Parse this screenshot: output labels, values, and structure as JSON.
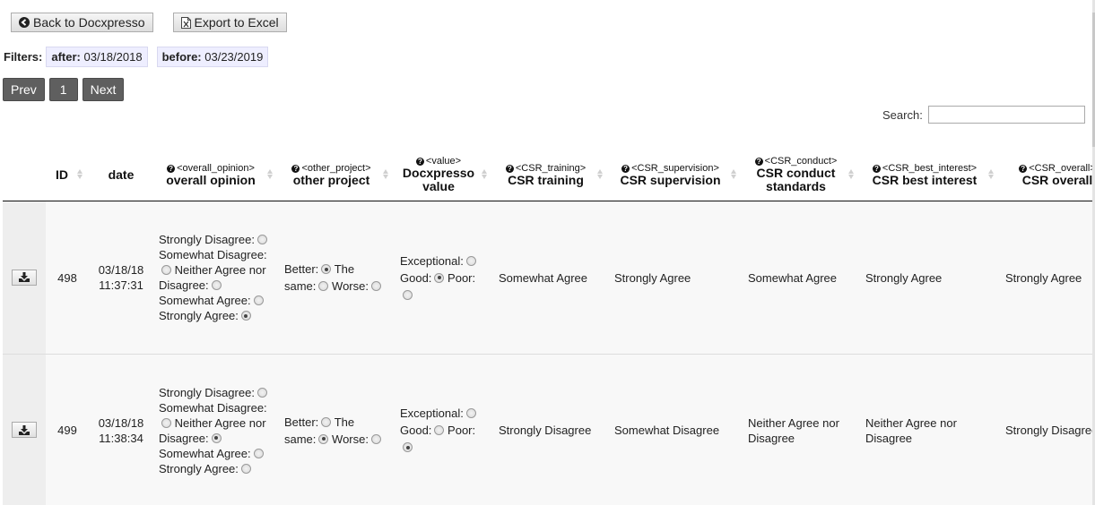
{
  "toolbar": {
    "back_label": "Back to Docxpresso",
    "export_label": "Export to Excel"
  },
  "filters": {
    "label": "Filters:",
    "after_key": "after:",
    "after_value": "03/18/2018",
    "before_key": "before:",
    "before_value": "03/23/2019"
  },
  "pager": {
    "prev": "Prev",
    "page": "1",
    "next": "Next"
  },
  "search": {
    "label": "Search:",
    "value": ""
  },
  "columns": [
    {
      "tag": "",
      "label": "ID"
    },
    {
      "tag": "",
      "label": "date"
    },
    {
      "tag": "<overall_opinion>",
      "label": "overall opinion"
    },
    {
      "tag": "<other_project>",
      "label": "other project"
    },
    {
      "tag": "<value>",
      "label": "Docxpresso value"
    },
    {
      "tag": "<CSR_training>",
      "label": "CSR training"
    },
    {
      "tag": "<CSR_supervision>",
      "label": "CSR supervision"
    },
    {
      "tag": "<CSR_conduct>",
      "label": "CSR conduct standards"
    },
    {
      "tag": "<CSR_best_interest>",
      "label": "CSR best interest"
    },
    {
      "tag": "<CSR_overall>",
      "label": "CSR overall"
    }
  ],
  "rows": [
    {
      "id": "498",
      "date_line1": "03/18/18",
      "date_line2": "11:37:31",
      "overall_opinion": [
        {
          "label": "Strongly Disagree:",
          "checked": false
        },
        {
          "label": "Somewhat Disagree:",
          "checked": false
        },
        {
          "label": "Neither Agree nor Disagree:",
          "checked": false
        },
        {
          "label": "Somewhat Agree:",
          "checked": false
        },
        {
          "label": "Strongly Agree:",
          "checked": true
        }
      ],
      "other_project": [
        {
          "label": "Better:",
          "checked": true
        },
        {
          "label": "The same:",
          "checked": false
        },
        {
          "label": "Worse:",
          "checked": false
        }
      ],
      "value": [
        {
          "label": "Exceptional:",
          "checked": false
        },
        {
          "label": "Good:",
          "checked": true
        },
        {
          "label": "Poor:",
          "checked": false
        }
      ],
      "csr_training": "Somewhat Agree",
      "csr_supervision": "Strongly Agree",
      "csr_conduct": "Somewhat Agree",
      "csr_best_interest": "Strongly Agree",
      "csr_overall": "Strongly Agree"
    },
    {
      "id": "499",
      "date_line1": "03/18/18",
      "date_line2": "11:38:34",
      "overall_opinion": [
        {
          "label": "Strongly Disagree:",
          "checked": false
        },
        {
          "label": "Somewhat Disagree:",
          "checked": false
        },
        {
          "label": "Neither Agree nor Disagree:",
          "checked": true
        },
        {
          "label": "Somewhat Agree:",
          "checked": false
        },
        {
          "label": "Strongly Agree:",
          "checked": false
        }
      ],
      "other_project": [
        {
          "label": "Better:",
          "checked": false
        },
        {
          "label": "The same:",
          "checked": true
        },
        {
          "label": "Worse:",
          "checked": false
        }
      ],
      "value": [
        {
          "label": "Exceptional:",
          "checked": false
        },
        {
          "label": "Good:",
          "checked": false
        },
        {
          "label": "Poor:",
          "checked": true
        }
      ],
      "csr_training": "Strongly Disagree",
      "csr_supervision": "Somewhat Disagree",
      "csr_conduct": "Neither Agree nor Disagree",
      "csr_best_interest": "Neither Agree nor Disagree",
      "csr_overall": "Strongly Disagree"
    }
  ],
  "icons": {
    "back": "circle-arrow-left-icon",
    "export": "excel-file-icon",
    "download": "download-icon",
    "help": "question-circle-icon"
  }
}
